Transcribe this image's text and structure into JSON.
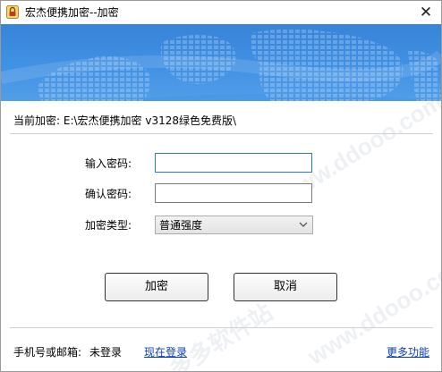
{
  "window": {
    "title": "宏杰便携加密--加密",
    "close_glyph": "✕"
  },
  "current": {
    "label": "当前加密:",
    "path": "E:\\宏杰便携加密 v3128绿色免费版\\"
  },
  "form": {
    "password_label": "输入密码:",
    "password_value": "",
    "confirm_label": "确认密码:",
    "confirm_value": "",
    "type_label": "加密类型:",
    "type_selected": "普通强度"
  },
  "buttons": {
    "encrypt": "加密",
    "cancel": "取消"
  },
  "footer": {
    "account_label": "手机号或邮箱:",
    "account_value": "未登录",
    "login_link": "现在登录",
    "more_link": "更多功能"
  },
  "watermark": {
    "text_1": "www.ddooo.com",
    "text_2": "多多软件站",
    "text_3": "www.ddooo.com"
  },
  "colors": {
    "banner": "#3a8de3",
    "link": "#0b3fb8",
    "focus_border": "#2a78d4"
  }
}
